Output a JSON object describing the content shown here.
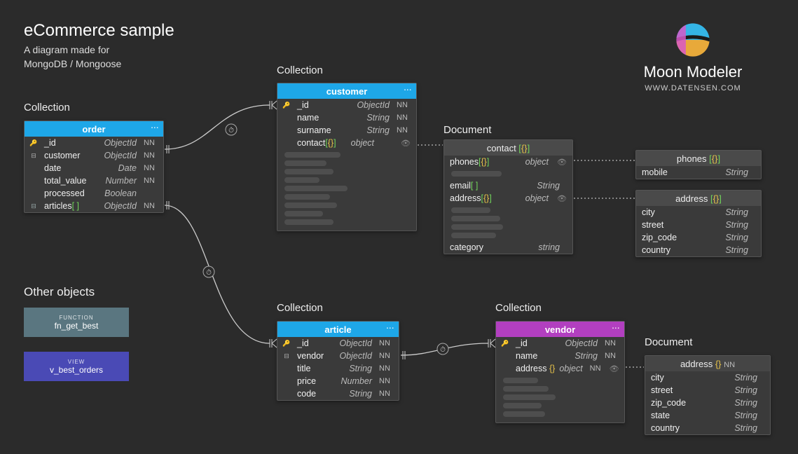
{
  "header": {
    "title": "eCommerce sample",
    "subtitle1": "A diagram made for",
    "subtitle2": "MongoDB / Mongoose"
  },
  "brand": {
    "name": "Moon Modeler",
    "url": "WWW.DATENSEN.COM"
  },
  "labels": {
    "collection": "Collection",
    "document": "Document",
    "other_objects": "Other objects"
  },
  "nn": "NN",
  "ellipsis": "...",
  "entities": {
    "order": {
      "title": "order",
      "fields": [
        {
          "name": "_id",
          "type": "ObjectId",
          "nn": true,
          "icon": "key"
        },
        {
          "name": "customer",
          "type": "ObjectId",
          "nn": true,
          "icon": "fk"
        },
        {
          "name": "date",
          "type": "Date",
          "nn": true
        },
        {
          "name": "total_value",
          "type": "Number",
          "nn": true
        },
        {
          "name": "processed",
          "type": "Boolean",
          "nn": false
        },
        {
          "name": "articles",
          "suffix": "[ ]",
          "type": "ObjectId",
          "nn": true,
          "icon": "arr"
        }
      ]
    },
    "customer": {
      "title": "customer",
      "fields": [
        {
          "name": "_id",
          "type": "ObjectId",
          "nn": true,
          "icon": "key"
        },
        {
          "name": "name",
          "type": "String",
          "nn": true
        },
        {
          "name": "surname",
          "type": "String",
          "nn": true
        },
        {
          "name": "contact",
          "suffix": "[{}]",
          "type": "object",
          "nn": false,
          "eye": true
        }
      ]
    },
    "article": {
      "title": "article",
      "fields": [
        {
          "name": "_id",
          "type": "ObjectId",
          "nn": true,
          "icon": "key"
        },
        {
          "name": "vendor",
          "type": "ObjectId",
          "nn": true,
          "icon": "fk"
        },
        {
          "name": "title",
          "type": "String",
          "nn": true
        },
        {
          "name": "price",
          "type": "Number",
          "nn": true
        },
        {
          "name": "code",
          "type": "String",
          "nn": true
        }
      ]
    },
    "vendor": {
      "title": "vendor",
      "fields": [
        {
          "name": "_id",
          "type": "ObjectId",
          "nn": true,
          "icon": "key"
        },
        {
          "name": "name",
          "type": "String",
          "nn": true
        },
        {
          "name": "address",
          "suffix": "{}",
          "type": "object",
          "nn": true,
          "eye": true
        }
      ]
    }
  },
  "docs": {
    "contact": {
      "title": "contact",
      "title_suffix": "[{}]",
      "rows": [
        {
          "name": "phones",
          "suffix": "[{}]",
          "type": "object",
          "eye": true
        },
        {
          "placeholder": true
        },
        {
          "name": "email",
          "suffix": "[ ]",
          "type": "String"
        },
        {
          "name": "address",
          "suffix": "[{}]",
          "type": "object",
          "eye": true
        },
        {
          "placeholder": true
        },
        {
          "placeholder": true
        },
        {
          "placeholder": true
        },
        {
          "placeholder": true
        },
        {
          "name": "category",
          "type": "string"
        }
      ]
    },
    "phones": {
      "title": "phones",
      "title_suffix": "[{}]",
      "rows": [
        {
          "name": "mobile",
          "type": "String"
        }
      ]
    },
    "address1": {
      "title": "address",
      "title_suffix": "[{}]",
      "rows": [
        {
          "name": "city",
          "type": "String"
        },
        {
          "name": "street",
          "type": "String"
        },
        {
          "name": "zip_code",
          "type": "String"
        },
        {
          "name": "country",
          "type": "String"
        }
      ]
    },
    "address2": {
      "title": "address",
      "title_suffix": "{} NN",
      "rows": [
        {
          "name": "city",
          "type": "String"
        },
        {
          "name": "street",
          "type": "String"
        },
        {
          "name": "zip_code",
          "type": "String"
        },
        {
          "name": "state",
          "type": "String"
        },
        {
          "name": "country",
          "type": "String"
        }
      ]
    }
  },
  "objects": {
    "func_tag": "FUNCTION",
    "func_name": "fn_get_best",
    "view_tag": "VIEW",
    "view_name": "v_best_orders"
  }
}
